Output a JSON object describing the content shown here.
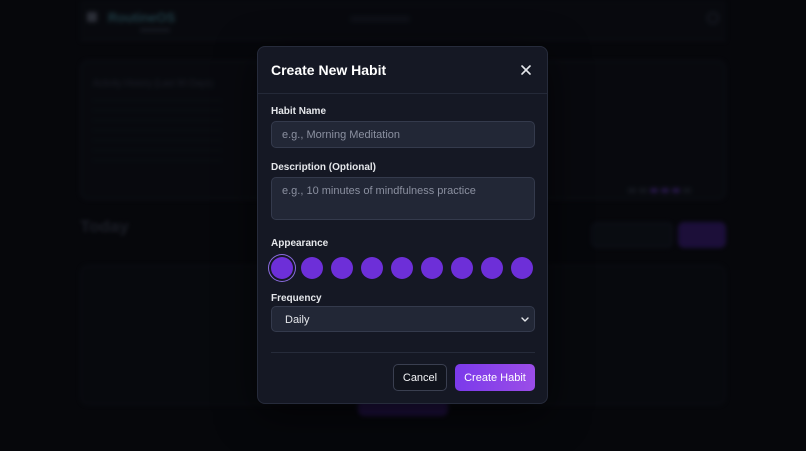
{
  "background": {
    "app_name": "RoutineOS",
    "activity_card_title": "Activity History (Last 90 Days)",
    "today_heading": "Today",
    "filter_label": "All Habits",
    "new_button_label": "New"
  },
  "modal": {
    "title": "Create New Habit",
    "close_icon": "close-icon",
    "habit_name": {
      "label": "Habit Name",
      "placeholder": "e.g., Morning Meditation",
      "value": ""
    },
    "description": {
      "label": "Description (Optional)",
      "placeholder": "e.g., 10 minutes of mindfulness practice",
      "value": ""
    },
    "appearance": {
      "label": "Appearance",
      "selected_index": 0,
      "colors": [
        "#6d2fd8",
        "#6d2fd8",
        "#6d2fd8",
        "#6d2fd8",
        "#6d2fd8",
        "#6d2fd8",
        "#6d2fd8",
        "#6d2fd8",
        "#6d2fd8"
      ]
    },
    "frequency": {
      "label": "Frequency",
      "selected": "Daily"
    },
    "buttons": {
      "cancel": "Cancel",
      "create": "Create Habit"
    }
  },
  "colors": {
    "accent": "#7b3aea",
    "modal_bg": "#151824",
    "input_bg": "#222736"
  }
}
